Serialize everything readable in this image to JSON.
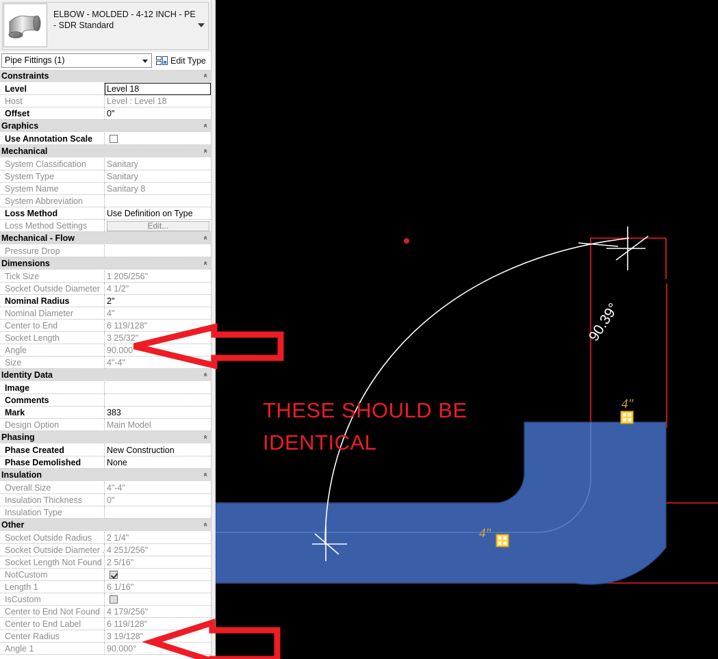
{
  "palette": {
    "type_name": "ELBOW - MOLDED - 4-12 INCH - PE - SDR Standard",
    "thumbnail_icon": "pipe-elbow-thumbnail",
    "category": "Pipe Fittings (1)",
    "edit_type_label": "Edit Type",
    "edit_type_icon": "edit-type-icon",
    "dropdown_icon": "chevron-down-icon",
    "collapse_icon": "«",
    "groups": [
      {
        "name": "Constraints",
        "rows": [
          {
            "label": "Level",
            "value": "Level 18",
            "dim": false,
            "bold": true,
            "selected": true
          },
          {
            "label": "Host",
            "value": "Level : Level 18",
            "dim": true,
            "bold": false
          },
          {
            "label": "Offset",
            "value": "0\"",
            "dim": false,
            "bold": true
          }
        ]
      },
      {
        "name": "Graphics",
        "rows": [
          {
            "label": "Use Annotation Scale",
            "value": "",
            "dim": false,
            "bold": true,
            "checkbox": "unchecked"
          }
        ]
      },
      {
        "name": "Mechanical",
        "rows": [
          {
            "label": "System Classification",
            "value": "Sanitary",
            "dim": true
          },
          {
            "label": "System Type",
            "value": "Sanitary",
            "dim": true
          },
          {
            "label": "System Name",
            "value": "Sanitary 8",
            "dim": true
          },
          {
            "label": "System Abbreviation",
            "value": "",
            "dim": true
          },
          {
            "label": "Loss Method",
            "value": "Use Definition on Type",
            "dim": false,
            "bold": true
          },
          {
            "label": "Loss Method Settings",
            "value": "Edit...",
            "dim": true,
            "button": true
          }
        ]
      },
      {
        "name": "Mechanical - Flow",
        "rows": [
          {
            "label": "Pressure Drop",
            "value": "",
            "dim": true
          }
        ]
      },
      {
        "name": "Dimensions",
        "rows": [
          {
            "label": "Tick Size",
            "value": "1 205/256\"",
            "dim": true
          },
          {
            "label": "Socket Outside Diameter",
            "value": "4 1/2\"",
            "dim": true
          },
          {
            "label": "Nominal Radius",
            "value": "2\"",
            "dim": false,
            "bold": true
          },
          {
            "label": "Nominal Diameter",
            "value": "4\"",
            "dim": true
          },
          {
            "label": "Center to End",
            "value": "6 119/128\"",
            "dim": true
          },
          {
            "label": "Socket Length",
            "value": "3 25/32\"",
            "dim": true
          },
          {
            "label": "Angle",
            "value": "90.000°",
            "dim": true
          },
          {
            "label": "Size",
            "value": "4\"-4\"",
            "dim": true
          }
        ]
      },
      {
        "name": "Identity Data",
        "rows": [
          {
            "label": "Image",
            "value": "",
            "dim": false,
            "bold": true
          },
          {
            "label": "Comments",
            "value": "",
            "dim": false,
            "bold": true
          },
          {
            "label": "Mark",
            "value": "383",
            "dim": false,
            "bold": true
          },
          {
            "label": "Design Option",
            "value": "Main Model",
            "dim": true
          }
        ]
      },
      {
        "name": "Phasing",
        "rows": [
          {
            "label": "Phase Created",
            "value": "New Construction",
            "dim": false,
            "bold": true
          },
          {
            "label": "Phase Demolished",
            "value": "None",
            "dim": false,
            "bold": true
          }
        ]
      },
      {
        "name": "Insulation",
        "rows": [
          {
            "label": "Overall Size",
            "value": "4\"-4\"",
            "dim": true
          },
          {
            "label": "Insulation Thickness",
            "value": "0\"",
            "dim": true
          },
          {
            "label": "Insulation Type",
            "value": "",
            "dim": true
          }
        ]
      },
      {
        "name": "Other",
        "rows": [
          {
            "label": "Socket Outside Radius",
            "value": "2 1/4\"",
            "dim": true
          },
          {
            "label": "Socket Outside Diameter ...",
            "value": "4 251/256\"",
            "dim": true
          },
          {
            "label": "Socket Length Not Found",
            "value": "2 5/16\"",
            "dim": true
          },
          {
            "label": "NotCustom",
            "value": "",
            "dim": true,
            "checkbox": "checked"
          },
          {
            "label": "Length 1",
            "value": "6 1/16\"",
            "dim": true
          },
          {
            "label": "IsCustom",
            "value": "",
            "dim": true,
            "checkbox": "gray"
          },
          {
            "label": "Center to End Not Found",
            "value": "4 179/256\"",
            "dim": true
          },
          {
            "label": "Center to End Label",
            "value": "6 119/128\"",
            "dim": true
          },
          {
            "label": "Center Radius",
            "value": "3 19/128\"",
            "dim": true
          },
          {
            "label": "Angle 1",
            "value": "90.000°",
            "dim": true
          }
        ]
      }
    ]
  },
  "canvas": {
    "background_color": "#000000",
    "annotation_color": "#ee1c24",
    "dimension_color": "#e8a33d",
    "element_color": "#3a5fa8",
    "reference_color": "#ee1c24",
    "note_line1": "THESE SHOULD BE",
    "note_line2": "IDENTICAL",
    "angle_dimension": "90.39°",
    "size_label_top": "4\"",
    "size_label_left": "4\"",
    "grip_icon": "drag-control-grip",
    "crosshair_icon": "snap-crosshair",
    "dot_icon": "origin-dot"
  }
}
